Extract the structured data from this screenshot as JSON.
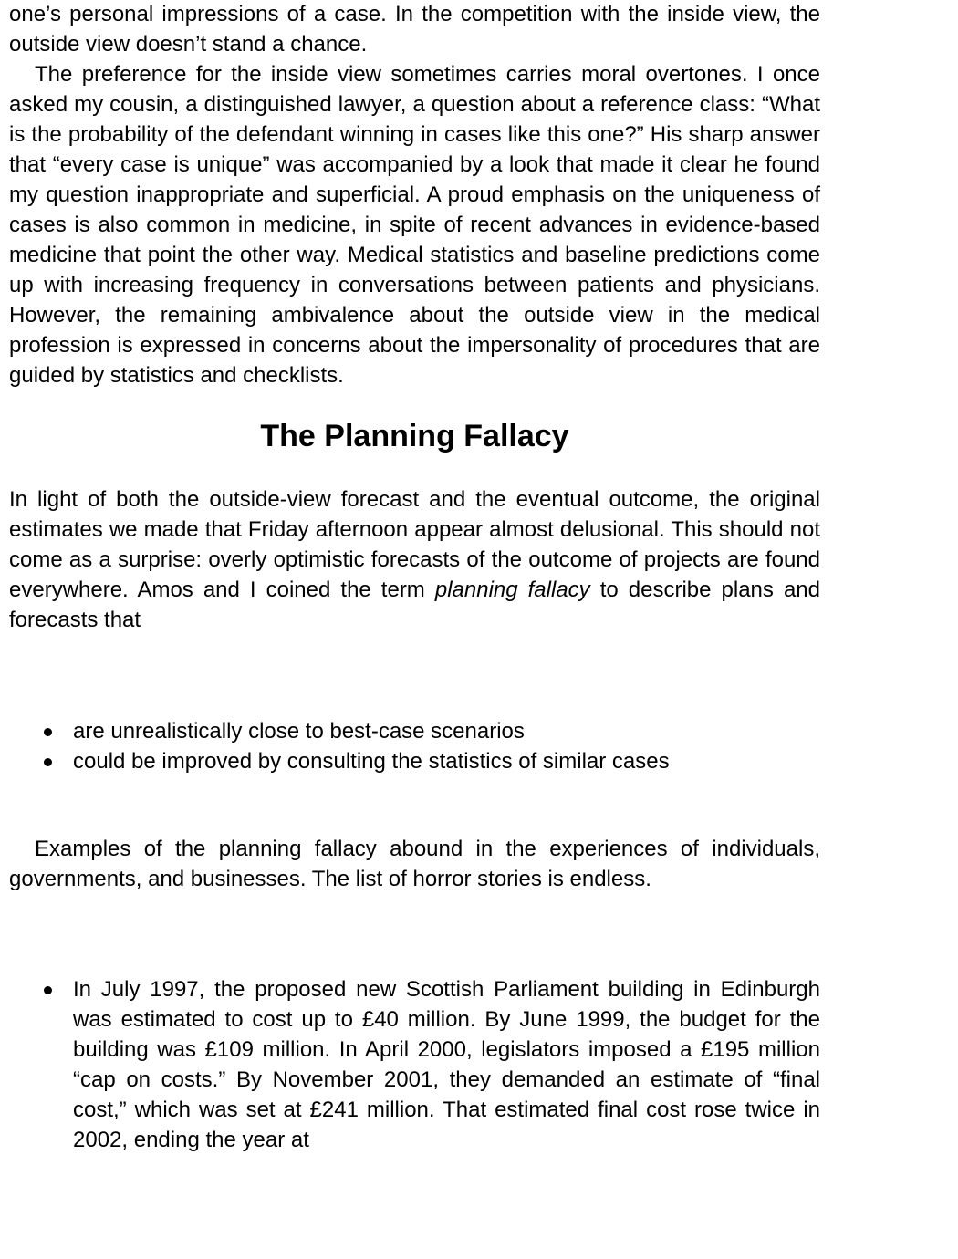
{
  "content": {
    "continued_paragraph": "one’s personal impressions of a case. In the competition with the inside view, the outside view doesn’t stand a chance.",
    "moral_paragraph": "The preference for the inside view sometimes carries moral overtones. I once asked my cousin, a distinguished lawyer, a question about a reference class: “What is the probability of the defendant winning in cases like this one?” His sharp answer that “every case is unique” was accompanied by a look that made it clear he found my question inappropriate and superficial. A proud emphasis on the uniqueness of cases is also common in medicine, in spite of recent advances in evidence-based medicine that point the other way. Medical statistics and baseline predictions come up with increasing frequency in conversations between patients and physicians. However, the remaining ambivalence about the outside view in the medical profession is expressed in concerns about the impersonality of procedures that are guided by statistics and checklists.",
    "section_heading": "The Planning Fallacy",
    "fallacy_paragraph_before": "In light of both the outside-view forecast and the eventual outcome, the original estimates we made that Friday afternoon appear almost delusional. This should not come as a surprise: overly optimistic forecasts of the outcome of projects are found everywhere. Amos and I coined the term ",
    "fallacy_paragraph_term": "planning fallacy",
    "fallacy_paragraph_after": " to describe plans and forecasts that",
    "definition_bullets": [
      "are unrealistically close to best-case scenarios",
      "could be improved by consulting the statistics of similar cases"
    ],
    "examples_paragraph": "Examples of the planning fallacy abound in the experiences of individuals, governments, and businesses. The list of horror stories is endless.",
    "example_bullets": [
      "In July 1997, the proposed new Scottish Parliament building in Edinburgh was estimated to cost up to £40 million. By June 1999, the budget for the building was £109 million. In April 2000, legislators imposed a £195 million “cap on costs.” By November 2001, they demanded an estimate of “final cost,” which was set at £241 million. That estimated final cost rose twice in 2002, ending the year at"
    ]
  }
}
